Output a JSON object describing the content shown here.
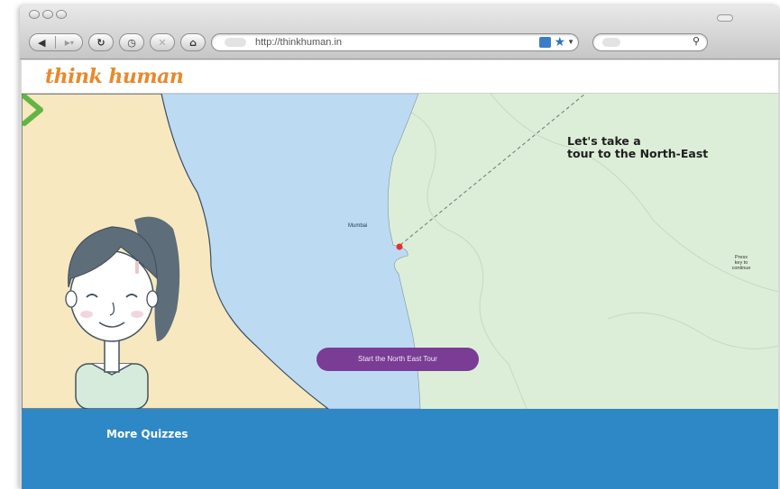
{
  "browser": {
    "url": "http://thinkhuman.in",
    "icons": [
      "back-icon",
      "forward-icon",
      "reload-icon",
      "history-icon",
      "stop-icon",
      "home-icon",
      "feed-icon",
      "bookmark-star-icon",
      "search-icon"
    ]
  },
  "site": {
    "logo": "think human",
    "logo_color": "#e8892b"
  },
  "map": {
    "city_label": "Mumbai",
    "sea_color": "#bcdaf2",
    "land_color": "#ddeed8",
    "marker_color": "#e53030"
  },
  "tour": {
    "heading": "Let's take a\ntour to the North-East",
    "press_hint": "Press\nkey to\ncontinue",
    "start_button": "Start the North East Tour",
    "button_color": "#7a3c94",
    "arrow_color": "#62b545"
  },
  "footer": {
    "more_quizzes": "More Quizzes",
    "color": "#2f88c6"
  }
}
